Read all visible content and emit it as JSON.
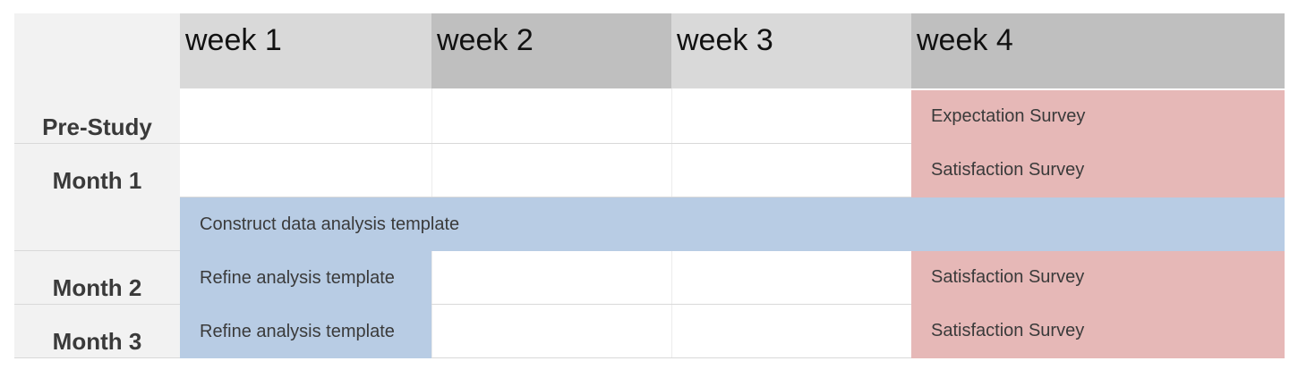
{
  "colors": {
    "header_light": "#d9d9d9",
    "header_dark": "#bfbfbf",
    "label_bg": "#f2f2f2",
    "survey": "#e6b8b7",
    "analysis": "#b8cce4"
  },
  "weeks": [
    "week 1",
    "week 2",
    "week 3",
    "week 4"
  ],
  "rows": [
    "Pre-Study",
    "Month 1",
    "Month 2",
    "Month 3"
  ],
  "tasks": {
    "expectation_survey": "Expectation Survey",
    "satisfaction_m1": "Satisfaction Survey",
    "construct_template": "Construct data analysis template",
    "refine_m2": "Refine analysis template",
    "satisfaction_m2": "Satisfaction Survey",
    "refine_m3": "Refine analysis template",
    "satisfaction_m3": "Satisfaction Survey"
  }
}
